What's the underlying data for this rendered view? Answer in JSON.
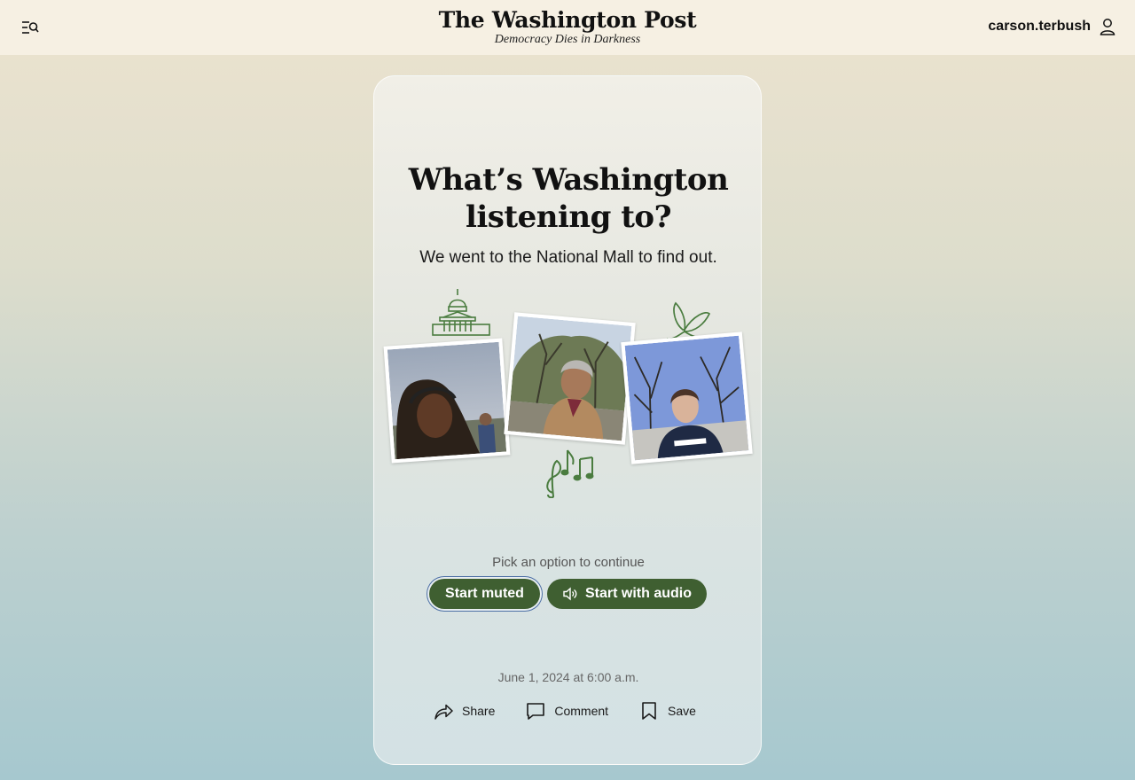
{
  "header": {
    "logo_text": "The Washington Post",
    "tagline": "Democracy Dies in Darkness",
    "username": "carson.terbush",
    "menu_icon": "menu-search-icon",
    "account_icon": "user-icon"
  },
  "story": {
    "headline_line1": "What’s Washington",
    "headline_line2": "listening to?",
    "dek": "We went to the National Mall to find out.",
    "prompt": "Pick an option to continue",
    "start_muted_label": "Start muted",
    "start_audio_label": "Start with audio",
    "dateline": "June 1, 2024 at 6:00 a.m."
  },
  "actions": {
    "share_label": "Share",
    "comment_label": "Comment",
    "save_label": "Save"
  },
  "colors": {
    "button_green": "#3f5f31",
    "doodle_green": "#4a7c3f",
    "focus_ring": "#4c6fa5"
  },
  "doodles": [
    "capitol-icon",
    "butterfly-icon",
    "music-notes-icon"
  ]
}
